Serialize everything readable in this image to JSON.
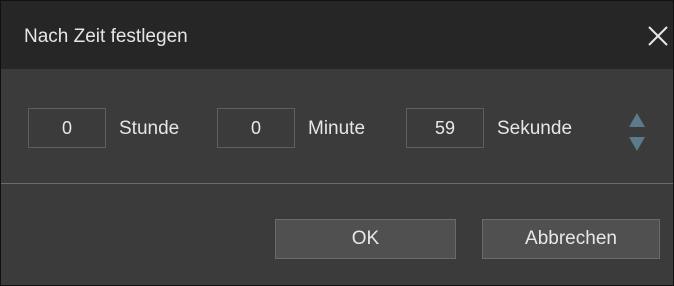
{
  "dialog": {
    "title": "Nach Zeit festlegen",
    "close_icon": "close-icon"
  },
  "time": {
    "hours": {
      "value": "0",
      "label": "Stunde"
    },
    "minutes": {
      "value": "0",
      "label": "Minute"
    },
    "seconds": {
      "value": "59",
      "label": "Sekunde"
    },
    "spinner_icons": [
      "arrow-up-icon",
      "arrow-down-icon"
    ]
  },
  "buttons": {
    "ok_label": "OK",
    "cancel_label": "Abbrechen"
  },
  "colors": {
    "background": "#3b3b3b",
    "titlebar": "#262626",
    "text": "#e6e6e6",
    "field_border": "#5f5f5f",
    "button_bg": "#505050",
    "spinner_arrow": "#5b7a8a"
  }
}
